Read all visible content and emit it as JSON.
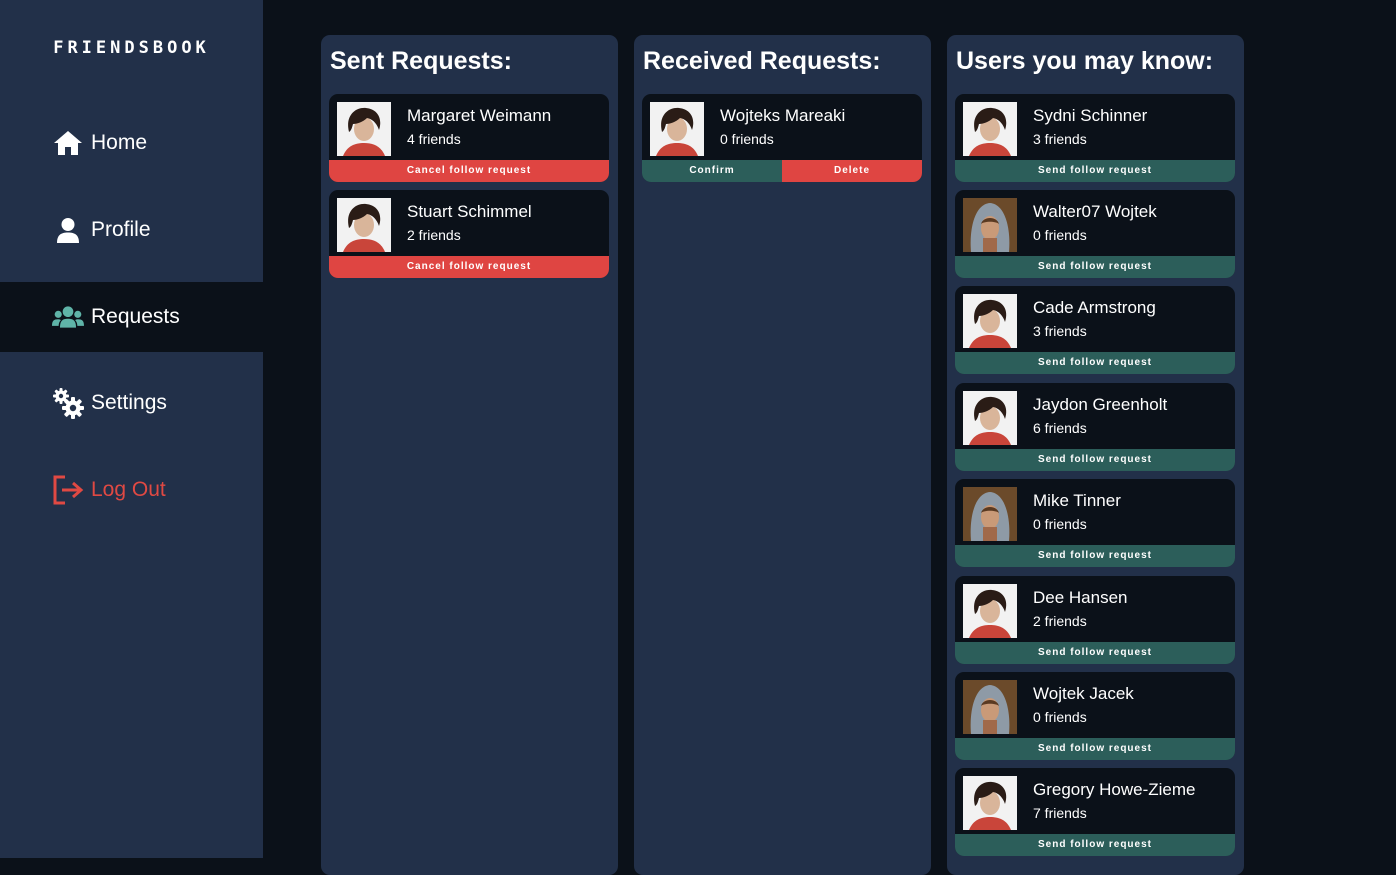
{
  "app": {
    "logo": "FRIENDSBOOK"
  },
  "sidebar": {
    "items": [
      {
        "label": "Home",
        "icon": "home-icon"
      },
      {
        "label": "Profile",
        "icon": "user-icon"
      },
      {
        "label": "Requests",
        "icon": "users-icon",
        "active": true
      },
      {
        "label": "Settings",
        "icon": "gears-icon"
      },
      {
        "label": "Log Out",
        "icon": "logout-icon"
      }
    ]
  },
  "colors": {
    "sidebar_bg": "#223049",
    "page_bg": "#0b1119",
    "danger": "#df4542",
    "confirm": "#2c5e5a",
    "accent_icon": "#5fb4a8"
  },
  "sent": {
    "title": "Sent Requests:",
    "items": [
      {
        "name": "Margaret Weimann",
        "friends": "4 friends",
        "action": "Cancel follow request",
        "avatar": "avatar-short-hair"
      },
      {
        "name": "Stuart Schimmel",
        "friends": "2 friends",
        "action": "Cancel follow request",
        "avatar": "avatar-short-hair"
      }
    ]
  },
  "received": {
    "title": "Received Requests:",
    "items": [
      {
        "name": "Wojteks Mareaki",
        "friends": "0 friends",
        "confirm": "Confirm",
        "delete": "Delete",
        "avatar": "avatar-short-hair"
      }
    ]
  },
  "suggested": {
    "title": "Users you may know:",
    "items": [
      {
        "name": "Sydni Schinner",
        "friends": "3 friends",
        "action": "Send follow request",
        "avatar": "avatar-short-hair"
      },
      {
        "name": "Walter07 Wojtek",
        "friends": "0 friends",
        "action": "Send follow request",
        "avatar": "avatar-hood"
      },
      {
        "name": "Cade Armstrong",
        "friends": "3 friends",
        "action": "Send follow request",
        "avatar": "avatar-short-hair"
      },
      {
        "name": "Jaydon Greenholt",
        "friends": "6 friends",
        "action": "Send follow request",
        "avatar": "avatar-short-hair"
      },
      {
        "name": "Mike Tinner",
        "friends": "0 friends",
        "action": "Send follow request",
        "avatar": "avatar-hood"
      },
      {
        "name": "Dee Hansen",
        "friends": "2 friends",
        "action": "Send follow request",
        "avatar": "avatar-short-hair"
      },
      {
        "name": "Wojtek Jacek",
        "friends": "0 friends",
        "action": "Send follow request",
        "avatar": "avatar-hood"
      },
      {
        "name": "Gregory Howe-Zieme",
        "friends": "7 friends",
        "action": "Send follow request",
        "avatar": "avatar-short-hair"
      }
    ]
  }
}
